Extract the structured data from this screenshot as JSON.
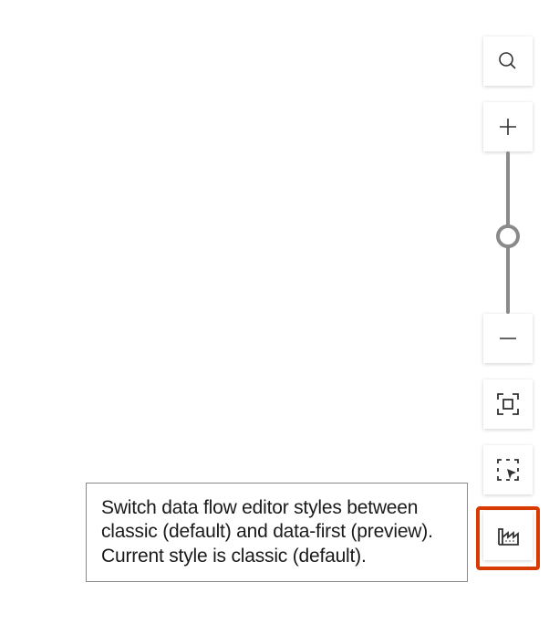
{
  "tooltip": {
    "text": "Switch data flow editor styles between classic (default) and data-first (preview). Current style is classic (default)."
  },
  "toolbar": {
    "search": "Search",
    "zoom_in": "Zoom in",
    "zoom_out": "Zoom out",
    "fit_to_screen": "Fit to screen",
    "select_area": "Select area",
    "switch_style": "Switch editor style"
  }
}
